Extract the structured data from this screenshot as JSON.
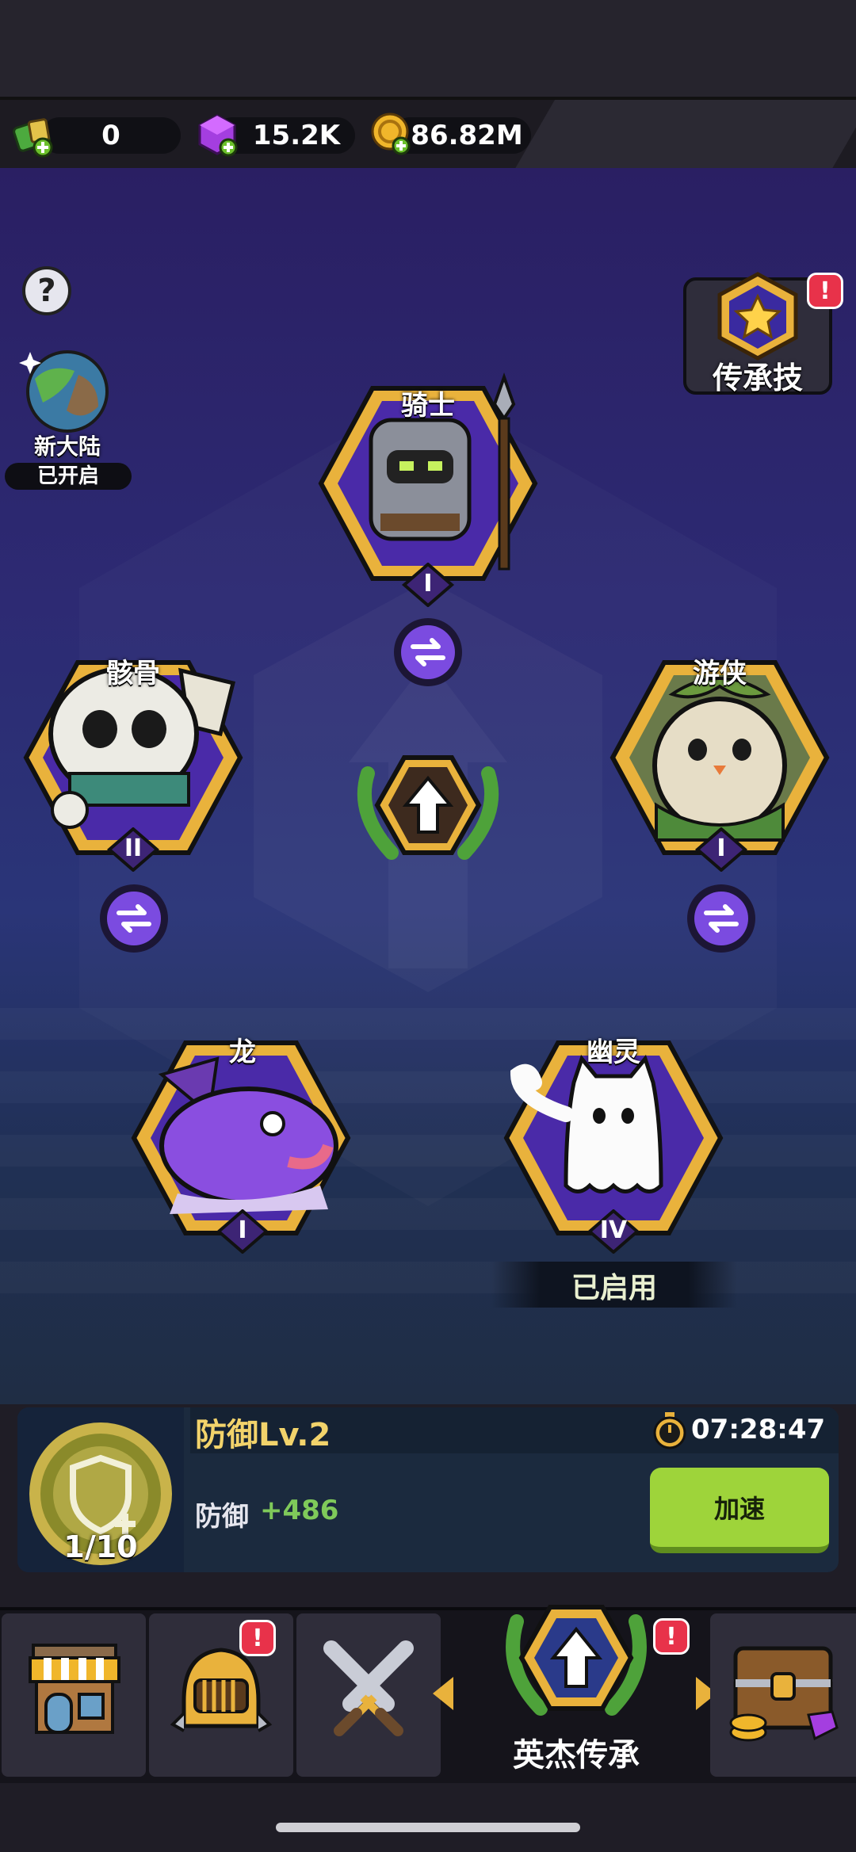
{
  "resources": {
    "tickets": "0",
    "gems": "15.2K",
    "gold": "86.82M"
  },
  "side": {
    "help_symbol": "?",
    "continent_label": "新大陆",
    "continent_status": "已开启",
    "legacy_skill_label": "传承技",
    "badge_symbol": "!"
  },
  "heroes": {
    "knight": {
      "name": "骑士",
      "rank": "I"
    },
    "skeleton": {
      "name": "骸骨",
      "rank": "II"
    },
    "ranger": {
      "name": "游侠",
      "rank": "I"
    },
    "dragon": {
      "name": "龙",
      "rank": "I"
    },
    "ghost": {
      "name": "幽灵",
      "rank": "IV",
      "status": "已启用"
    }
  },
  "upgrade": {
    "title": "防御Lv.2",
    "timer": "07:28:47",
    "stat_label": "防御",
    "stat_value": "+486",
    "progress": "1/10",
    "speed_button": "加速"
  },
  "nav": {
    "active_label": "英杰传承",
    "icons": [
      "shop-icon",
      "helmet-icon",
      "crossed-swords-icon",
      "legacy-upgrade-icon",
      "treasure-chest-icon"
    ]
  },
  "colors": {
    "accent_gold": "#e9b23c",
    "hex_purple": "#4a2aa8",
    "speed_green": "#9ed43a",
    "stat_green": "#7fc95a",
    "badge_red": "#e8324a"
  }
}
